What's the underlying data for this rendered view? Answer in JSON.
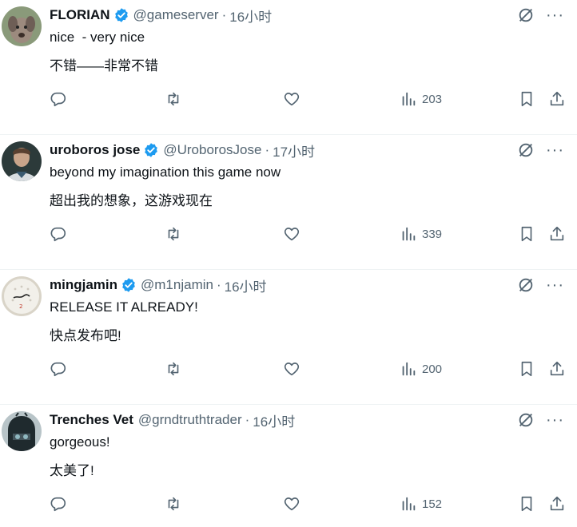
{
  "colors": {
    "verified": "#1d9bf0",
    "secondary_text": "#536471",
    "primary_text": "#0f1419",
    "divider": "#eff3f4"
  },
  "tweets": [
    {
      "name": "FLORIAN",
      "handle": "@gameserver",
      "separator": "·",
      "time": "16小时",
      "text_en": "nice  - very nice",
      "text_zh": "不错——非常不错",
      "views": "203",
      "avatar": "dog-avatar"
    },
    {
      "name": "uroboros jose",
      "handle": "@UroborosJose",
      "separator": "·",
      "time": "17小时",
      "text_en": "beyond my imagination this game now",
      "text_zh": "超出我的想象，这游戏现在",
      "views": "339",
      "avatar": "person-avatar"
    },
    {
      "name": "mingjamin",
      "handle": "@m1njamin",
      "separator": "·",
      "time": "16小时",
      "text_en": "RELEASE IT ALREADY!",
      "text_zh": "快点发布吧!",
      "views": "200",
      "avatar": "golf-ball-avatar"
    },
    {
      "name": "Trenches Vet",
      "handle": "@grndtruthtrader",
      "separator": "·",
      "time": "16小时",
      "text_en": "gorgeous!",
      "text_zh": "太美了!",
      "views": "152",
      "avatar": "helmet-avatar"
    }
  ],
  "more_label": "···"
}
